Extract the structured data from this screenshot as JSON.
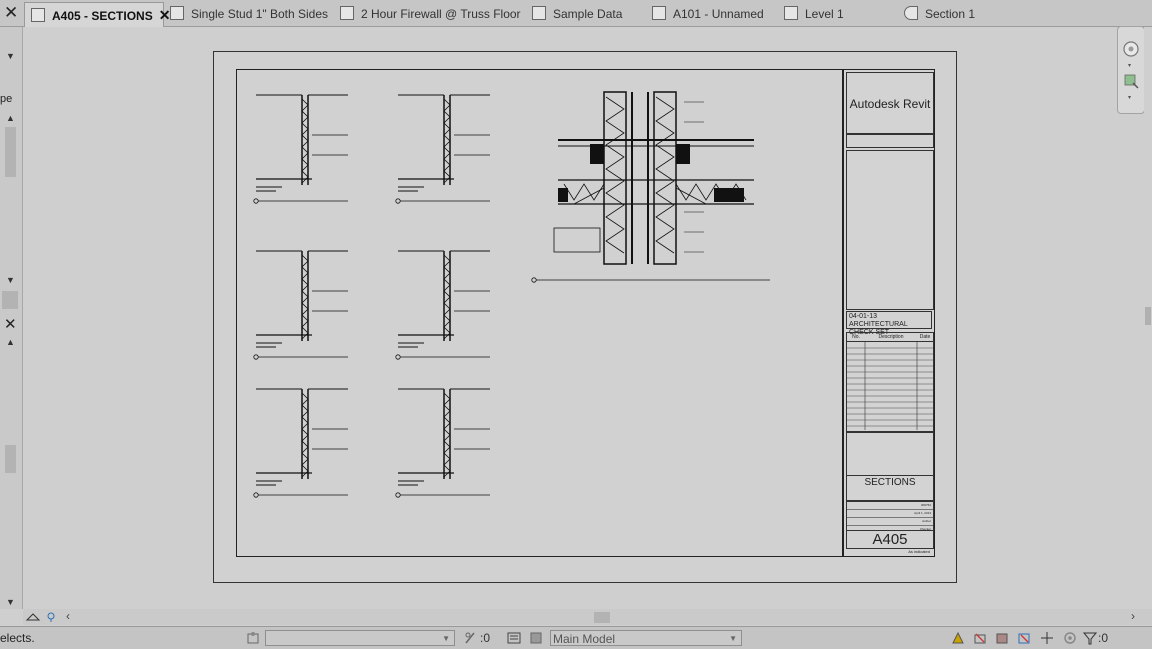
{
  "tabs": [
    {
      "label": "A405 - SECTIONS",
      "active": true
    },
    {
      "label": "Single Stud 1\" Both Sides",
      "active": false
    },
    {
      "label": "2 Hour Firewall @ Truss Floor",
      "active": false
    },
    {
      "label": "Sample Data",
      "active": false
    },
    {
      "label": "A101 - Unnamed",
      "active": false
    },
    {
      "label": "Level 1",
      "active": false
    },
    {
      "label": "Section 1",
      "active": false
    }
  ],
  "left_panel": {
    "fragment": "pe"
  },
  "titleblock": {
    "logo": "Autodesk Revit",
    "issue_set": "04-01-13 ARCHITECTURAL CHECK SET",
    "rev_headers": [
      "No.",
      "Description",
      "Date"
    ],
    "sheet_name": "SECTIONS",
    "info": [
      {
        "value": "006752"
      },
      {
        "value": "April 1, 2013"
      },
      {
        "value": "Author"
      },
      {
        "value": "Checker"
      }
    ],
    "sheet_number": "A405",
    "scale": "As indicated"
  },
  "status": {
    "message": "elects.",
    "selection_count": ":0",
    "model": "Main Model",
    "filter_count": ":0"
  },
  "colors": {
    "background": "#cfcfcf",
    "tabbar": "#c6c6c6",
    "line": "#111111"
  }
}
